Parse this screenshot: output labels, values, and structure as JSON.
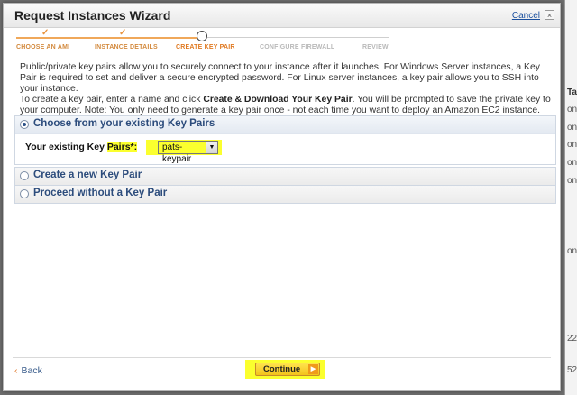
{
  "window": {
    "title": "Request Instances Wizard",
    "cancel_label": "Cancel",
    "close_glyph": "×"
  },
  "steps": [
    {
      "label": "CHOOSE AN AMI",
      "state": "done"
    },
    {
      "label": "INSTANCE DETAILS",
      "state": "done"
    },
    {
      "label": "CREATE KEY PAIR",
      "state": "current"
    },
    {
      "label": "CONFIGURE FIREWALL",
      "state": "todo"
    },
    {
      "label": "REVIEW",
      "state": "todo"
    }
  ],
  "intro": {
    "p1": "Public/private key pairs allow you to securely connect to your instance after it launches. For Windows Server instances, a Key Pair is required to set and deliver a secure encrypted password. For Linux server instances, a key pair allows you to SSH into your instance.",
    "p2_before": "To create a key pair, enter a name and click ",
    "p2_bold": "Create & Download Your Key Pair",
    "p2_after": ". You will be prompted to save the private key to your computer. Note: You only need to generate a key pair once - not each time you want to deploy an Amazon EC2 instance."
  },
  "options": {
    "existing": {
      "label": "Choose from your existing Key Pairs",
      "field_label_a": "Your existing Key ",
      "field_label_b": "Pairs*:",
      "selected": "pats-keypair"
    },
    "create": {
      "label": "Create a new Key Pair"
    },
    "none": {
      "label": "Proceed without a Key Pair"
    }
  },
  "footer": {
    "back_label": "Back",
    "continue_label": "Continue"
  },
  "background": {
    "fragments": [
      "Ta",
      "on",
      "on",
      "on",
      "on",
      "on",
      "on",
      "22",
      "52"
    ]
  },
  "colors": {
    "accent_orange": "#e07a22",
    "highlight_yellow": "#fbff2e",
    "link_blue": "#1a4f9e",
    "option_text": "#2c4c7c"
  },
  "icons": {
    "check": "check-icon",
    "close": "close-icon",
    "back": "chevron-left-icon",
    "continue": "arrow-right-icon",
    "dropdown": "triangle-down-icon"
  }
}
